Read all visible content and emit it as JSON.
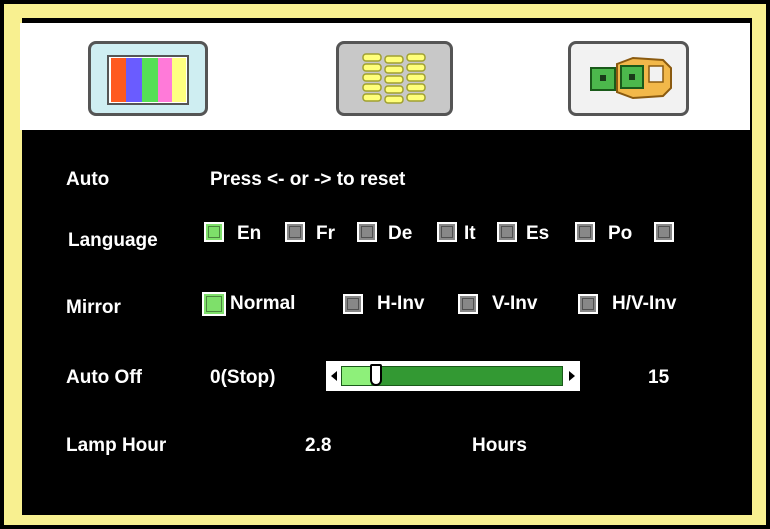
{
  "tabs": [
    {
      "name": "color"
    },
    {
      "name": "image"
    },
    {
      "name": "setup"
    }
  ],
  "rows": {
    "auto": {
      "label": "Auto",
      "value": "Press <- or -> to reset"
    },
    "language": {
      "label": "Language",
      "options": [
        "En",
        "Fr",
        "De",
        "It",
        "Es",
        "Po"
      ],
      "selected": "En"
    },
    "mirror": {
      "label": "Mirror",
      "options": [
        "Normal",
        "H-Inv",
        "V-Inv",
        "H/V-Inv"
      ],
      "selected": "Normal"
    },
    "auto_off": {
      "label": "Auto Off",
      "min_label": "0(Stop)",
      "max_label": "15",
      "value_fraction": 0.13
    },
    "lamp_hour": {
      "label": "Lamp Hour",
      "value": "2.8",
      "unit": "Hours"
    }
  },
  "colors": {
    "frame": "#f8f090",
    "selected": "#7ee06a",
    "unselected": "#888888",
    "slider_fill": "#339933"
  }
}
